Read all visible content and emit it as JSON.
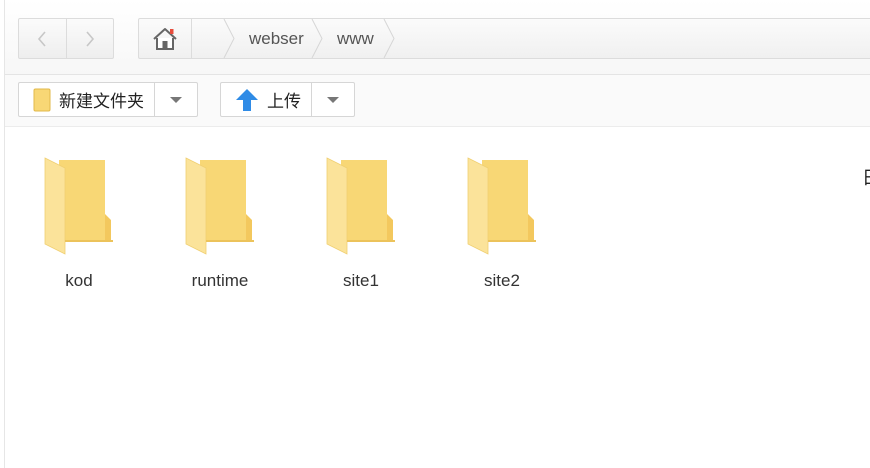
{
  "nav": {
    "back_icon": "chevron-left-icon",
    "forward_icon": "chevron-right-icon"
  },
  "address": {
    "home_icon": "home-icon",
    "crumbs": [
      "webser",
      "www"
    ]
  },
  "toolbar": {
    "new_folder_label": "新建文件夹",
    "upload_label": "上传"
  },
  "files": [
    {
      "name": "kod",
      "type": "folder"
    },
    {
      "name": "runtime",
      "type": "folder"
    },
    {
      "name": "site1",
      "type": "folder"
    },
    {
      "name": "site2",
      "type": "folder"
    }
  ],
  "edge_text": "日",
  "colors": {
    "folder": "#f8d775",
    "upload_arrow": "#2f8be6",
    "home_accent": "#e74c3c"
  }
}
